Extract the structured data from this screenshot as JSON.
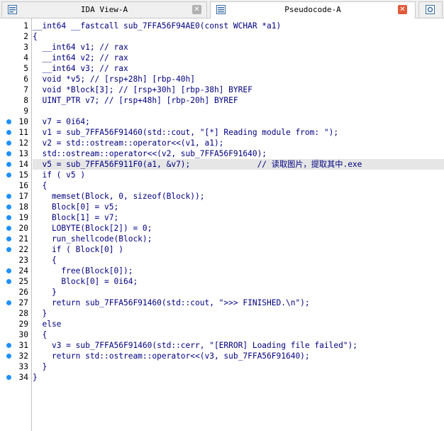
{
  "tabs": [
    {
      "label": "IDA View-A",
      "icon": "ida-view-icon",
      "active": false
    },
    {
      "label": "Pseudocode-A",
      "icon": "pseudocode-icon",
      "active": true
    },
    {
      "label": "",
      "icon": "hex-view-icon",
      "active": false
    }
  ],
  "lines": [
    {
      "n": "1",
      "dot": false,
      "hl": false,
      "text": "__int64 __fastcall sub_7FFA56F94AE0(const WCHAR *a1)"
    },
    {
      "n": "2",
      "dot": false,
      "hl": false,
      "text": "{"
    },
    {
      "n": "3",
      "dot": false,
      "hl": false,
      "text": "  __int64 v1; // rax"
    },
    {
      "n": "4",
      "dot": false,
      "hl": false,
      "text": "  __int64 v2; // rax"
    },
    {
      "n": "5",
      "dot": false,
      "hl": false,
      "text": "  __int64 v3; // rax"
    },
    {
      "n": "6",
      "dot": false,
      "hl": false,
      "text": "  void *v5; // [rsp+28h] [rbp-40h]"
    },
    {
      "n": "7",
      "dot": false,
      "hl": false,
      "text": "  void *Block[3]; // [rsp+30h] [rbp-38h] BYREF"
    },
    {
      "n": "8",
      "dot": false,
      "hl": false,
      "text": "  UINT_PTR v7; // [rsp+48h] [rbp-20h] BYREF"
    },
    {
      "n": "9",
      "dot": false,
      "hl": false,
      "text": ""
    },
    {
      "n": "10",
      "dot": true,
      "hl": false,
      "text": "  v7 = 0i64;"
    },
    {
      "n": "11",
      "dot": true,
      "hl": false,
      "text": "  v1 = sub_7FFA56F91460(std::cout, \"[*] Reading module from: \");"
    },
    {
      "n": "12",
      "dot": true,
      "hl": false,
      "text": "  v2 = std::ostream::operator<<(v1, a1);"
    },
    {
      "n": "13",
      "dot": true,
      "hl": false,
      "text": "  std::ostream::operator<<(v2, sub_7FFA56F91640);"
    },
    {
      "n": "14",
      "dot": true,
      "hl": true,
      "text": "  v5 = sub_7FFA56F911F0(a1, &v7);              // 读取图片，提取其中.exe"
    },
    {
      "n": "15",
      "dot": true,
      "hl": false,
      "text": "  if ( v5 )"
    },
    {
      "n": "16",
      "dot": false,
      "hl": false,
      "text": "  {"
    },
    {
      "n": "17",
      "dot": true,
      "hl": false,
      "text": "    memset(Block, 0, sizeof(Block));"
    },
    {
      "n": "18",
      "dot": true,
      "hl": false,
      "text": "    Block[0] = v5;"
    },
    {
      "n": "19",
      "dot": true,
      "hl": false,
      "text": "    Block[1] = v7;"
    },
    {
      "n": "20",
      "dot": true,
      "hl": false,
      "text": "    LOBYTE(Block[2]) = 0;"
    },
    {
      "n": "21",
      "dot": true,
      "hl": false,
      "text": "    run_shellcode(Block);"
    },
    {
      "n": "22",
      "dot": true,
      "hl": false,
      "text": "    if ( Block[0] )"
    },
    {
      "n": "23",
      "dot": false,
      "hl": false,
      "text": "    {"
    },
    {
      "n": "24",
      "dot": true,
      "hl": false,
      "text": "      free(Block[0]);"
    },
    {
      "n": "25",
      "dot": true,
      "hl": false,
      "text": "      Block[0] = 0i64;"
    },
    {
      "n": "26",
      "dot": false,
      "hl": false,
      "text": "    }"
    },
    {
      "n": "27",
      "dot": true,
      "hl": false,
      "text": "    return sub_7FFA56F91460(std::cout, \">>> FINISHED.\\n\");"
    },
    {
      "n": "28",
      "dot": false,
      "hl": false,
      "text": "  }"
    },
    {
      "n": "29",
      "dot": false,
      "hl": false,
      "text": "  else"
    },
    {
      "n": "30",
      "dot": false,
      "hl": false,
      "text": "  {"
    },
    {
      "n": "31",
      "dot": true,
      "hl": false,
      "text": "    v3 = sub_7FFA56F91460(std::cerr, \"[ERROR] Loading file failed\");"
    },
    {
      "n": "32",
      "dot": true,
      "hl": false,
      "text": "    return std::ostream::operator<<(v3, sub_7FFA56F91640);"
    },
    {
      "n": "33",
      "dot": false,
      "hl": false,
      "text": "  }"
    },
    {
      "n": "34",
      "dot": true,
      "hl": false,
      "text": "}"
    }
  ],
  "colors": {
    "keyword": "#000080",
    "comment": "#808080",
    "string": "#008000",
    "highlight": "#e6e6e6",
    "breakpoint_dot": "#1e90ff",
    "tab_close": "#e05a3a"
  }
}
